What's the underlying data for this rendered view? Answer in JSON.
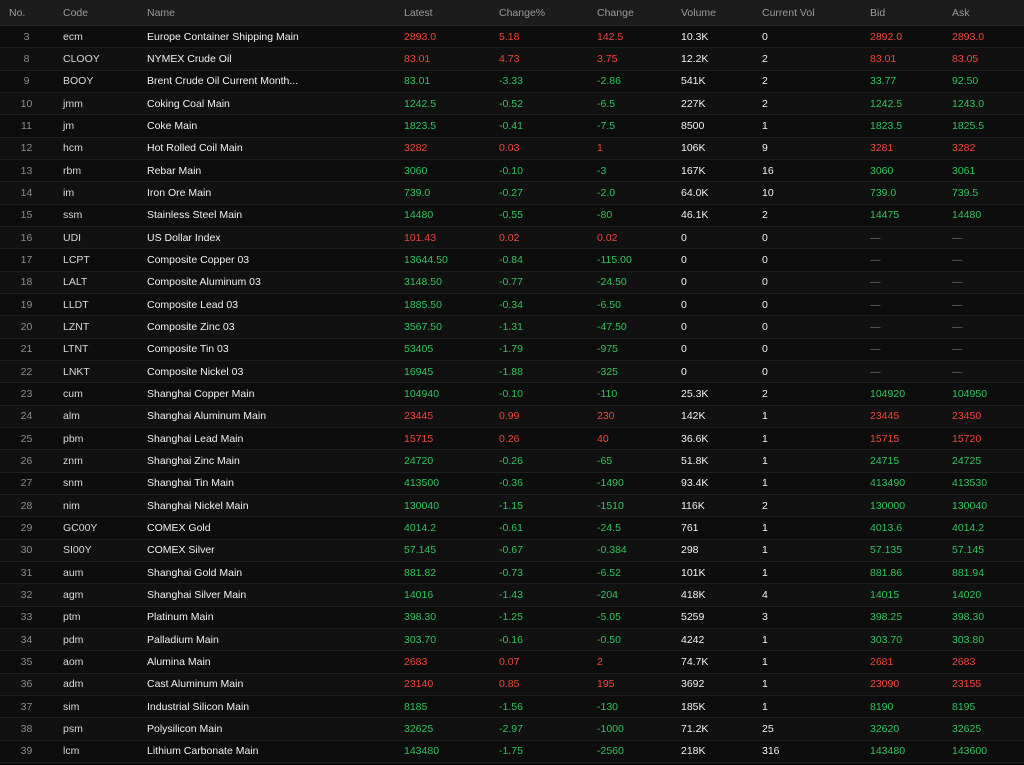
{
  "colors": {
    "up": "#f0443a",
    "down": "#2fc35a",
    "neutral": "#6e6e6e",
    "background": "#0d0d0d",
    "header": "#1c1c1c"
  },
  "headers": {
    "no": "No.",
    "code": "Code",
    "name": "Name",
    "latest": "Latest",
    "change_pct": "Change%",
    "change": "Change",
    "volume": "Volume",
    "current_vol": "Current Vol",
    "bid": "Bid",
    "ask": "Ask"
  },
  "rows": [
    {
      "no": "3",
      "code": "ecm",
      "name": "Europe Container Shipping Main",
      "latest": "2893.0",
      "pct": "5.18",
      "chg": "142.5",
      "vol": "10.3K",
      "cvol": "0",
      "bid": "2892.0",
      "ask": "2893.0",
      "dir": "up",
      "bid_dir": "up",
      "ask_dir": "up"
    },
    {
      "no": "8",
      "code": "CLOOY",
      "name": "NYMEX Crude Oil",
      "latest": "83.01",
      "pct": "4.73",
      "chg": "3.75",
      "vol": "12.2K",
      "cvol": "2",
      "bid": "83.01",
      "ask": "83.05",
      "dir": "up",
      "bid_dir": "up",
      "ask_dir": "up"
    },
    {
      "no": "9",
      "code": "BOOY",
      "name": "Brent Crude Oil Current Month...",
      "latest": "83.01",
      "pct": "-3.33",
      "chg": "-2.86",
      "vol": "541K",
      "cvol": "2",
      "bid": "33.77",
      "ask": "92.50",
      "dir": "down",
      "bid_dir": "down",
      "ask_dir": "down"
    },
    {
      "no": "10",
      "code": "jmm",
      "name": "Coking Coal Main",
      "latest": "1242.5",
      "pct": "-0.52",
      "chg": "-6.5",
      "vol": "227K",
      "cvol": "2",
      "bid": "1242.5",
      "ask": "1243.0",
      "dir": "down",
      "bid_dir": "down",
      "ask_dir": "down"
    },
    {
      "no": "11",
      "code": "jm",
      "name": "Coke Main",
      "latest": "1823.5",
      "pct": "-0.41",
      "chg": "-7.5",
      "vol": "8500",
      "cvol": "1",
      "bid": "1823.5",
      "ask": "1825.5",
      "dir": "down",
      "bid_dir": "down",
      "ask_dir": "down"
    },
    {
      "no": "12",
      "code": "hcm",
      "name": "Hot Rolled Coil Main",
      "latest": "3282",
      "pct": "0.03",
      "chg": "1",
      "vol": "106K",
      "cvol": "9",
      "bid": "3281",
      "ask": "3282",
      "dir": "up",
      "bid_dir": "up",
      "ask_dir": "up"
    },
    {
      "no": "13",
      "code": "rbm",
      "name": "Rebar Main",
      "latest": "3060",
      "pct": "-0.10",
      "chg": "-3",
      "vol": "167K",
      "cvol": "16",
      "bid": "3060",
      "ask": "3061",
      "dir": "down",
      "bid_dir": "down",
      "ask_dir": "down"
    },
    {
      "no": "14",
      "code": "im",
      "name": "Iron Ore Main",
      "latest": "739.0",
      "pct": "-0.27",
      "chg": "-2.0",
      "vol": "64.0K",
      "cvol": "10",
      "bid": "739.0",
      "ask": "739.5",
      "dir": "down",
      "bid_dir": "down",
      "ask_dir": "down"
    },
    {
      "no": "15",
      "code": "ssm",
      "name": "Stainless Steel Main",
      "latest": "14480",
      "pct": "-0.55",
      "chg": "-80",
      "vol": "46.1K",
      "cvol": "2",
      "bid": "14475",
      "ask": "14480",
      "dir": "down",
      "bid_dir": "down",
      "ask_dir": "down"
    },
    {
      "no": "16",
      "code": "UDI",
      "name": "US Dollar Index",
      "latest": "101.43",
      "pct": "0.02",
      "chg": "0.02",
      "vol": "0",
      "cvol": "0",
      "bid": "—",
      "ask": "—",
      "dir": "up",
      "bid_dir": "flat",
      "ask_dir": "flat"
    },
    {
      "no": "17",
      "code": "LCPT",
      "name": "Composite Copper 03",
      "latest": "13644.50",
      "pct": "-0.84",
      "chg": "-115.00",
      "vol": "0",
      "cvol": "0",
      "bid": "—",
      "ask": "—",
      "dir": "down",
      "bid_dir": "flat",
      "ask_dir": "flat"
    },
    {
      "no": "18",
      "code": "LALT",
      "name": "Composite Aluminum 03",
      "latest": "3148.50",
      "pct": "-0.77",
      "chg": "-24.50",
      "vol": "0",
      "cvol": "0",
      "bid": "—",
      "ask": "—",
      "dir": "down",
      "bid_dir": "flat",
      "ask_dir": "flat"
    },
    {
      "no": "19",
      "code": "LLDT",
      "name": "Composite Lead 03",
      "latest": "1885.50",
      "pct": "-0.34",
      "chg": "-6.50",
      "vol": "0",
      "cvol": "0",
      "bid": "—",
      "ask": "—",
      "dir": "down",
      "bid_dir": "flat",
      "ask_dir": "flat"
    },
    {
      "no": "20",
      "code": "LZNT",
      "name": "Composite Zinc 03",
      "latest": "3567.50",
      "pct": "-1.31",
      "chg": "-47.50",
      "vol": "0",
      "cvol": "0",
      "bid": "—",
      "ask": "—",
      "dir": "down",
      "bid_dir": "flat",
      "ask_dir": "flat"
    },
    {
      "no": "21",
      "code": "LTNT",
      "name": "Composite Tin 03",
      "latest": "53405",
      "pct": "-1.79",
      "chg": "-975",
      "vol": "0",
      "cvol": "0",
      "bid": "—",
      "ask": "—",
      "dir": "down",
      "bid_dir": "flat",
      "ask_dir": "flat"
    },
    {
      "no": "22",
      "code": "LNKT",
      "name": "Composite Nickel 03",
      "latest": "16945",
      "pct": "-1.88",
      "chg": "-325",
      "vol": "0",
      "cvol": "0",
      "bid": "—",
      "ask": "—",
      "dir": "down",
      "bid_dir": "flat",
      "ask_dir": "flat"
    },
    {
      "no": "23",
      "code": "cum",
      "name": "Shanghai Copper Main",
      "latest": "104940",
      "pct": "-0.10",
      "chg": "-110",
      "vol": "25.3K",
      "cvol": "2",
      "bid": "104920",
      "ask": "104950",
      "dir": "down",
      "bid_dir": "down",
      "ask_dir": "down"
    },
    {
      "no": "24",
      "code": "alm",
      "name": "Shanghai Aluminum Main",
      "latest": "23445",
      "pct": "0.99",
      "chg": "230",
      "vol": "142K",
      "cvol": "1",
      "bid": "23445",
      "ask": "23450",
      "dir": "up",
      "bid_dir": "up",
      "ask_dir": "up"
    },
    {
      "no": "25",
      "code": "pbm",
      "name": "Shanghai Lead Main",
      "latest": "15715",
      "pct": "0.26",
      "chg": "40",
      "vol": "36.6K",
      "cvol": "1",
      "bid": "15715",
      "ask": "15720",
      "dir": "up",
      "bid_dir": "up",
      "ask_dir": "up"
    },
    {
      "no": "26",
      "code": "znm",
      "name": "Shanghai Zinc Main",
      "latest": "24720",
      "pct": "-0.26",
      "chg": "-65",
      "vol": "51.8K",
      "cvol": "1",
      "bid": "24715",
      "ask": "24725",
      "dir": "down",
      "bid_dir": "down",
      "ask_dir": "down"
    },
    {
      "no": "27",
      "code": "snm",
      "name": "Shanghai Tin Main",
      "latest": "413500",
      "pct": "-0.36",
      "chg": "-1490",
      "vol": "93.4K",
      "cvol": "1",
      "bid": "413490",
      "ask": "413530",
      "dir": "down",
      "bid_dir": "down",
      "ask_dir": "down"
    },
    {
      "no": "28",
      "code": "nim",
      "name": "Shanghai Nickel Main",
      "latest": "130040",
      "pct": "-1.15",
      "chg": "-1510",
      "vol": "116K",
      "cvol": "2",
      "bid": "130000",
      "ask": "130040",
      "dir": "down",
      "bid_dir": "down",
      "ask_dir": "down"
    },
    {
      "no": "29",
      "code": "GC00Y",
      "name": "COMEX Gold",
      "latest": "4014.2",
      "pct": "-0.61",
      "chg": "-24.5",
      "vol": "761",
      "cvol": "1",
      "bid": "4013.6",
      "ask": "4014.2",
      "dir": "down",
      "bid_dir": "down",
      "ask_dir": "down"
    },
    {
      "no": "30",
      "code": "SI00Y",
      "name": "COMEX Silver",
      "latest": "57.145",
      "pct": "-0.67",
      "chg": "-0.384",
      "vol": "298",
      "cvol": "1",
      "bid": "57.135",
      "ask": "57.145",
      "dir": "down",
      "bid_dir": "down",
      "ask_dir": "down"
    },
    {
      "no": "31",
      "code": "aum",
      "name": "Shanghai Gold Main",
      "latest": "881.82",
      "pct": "-0.73",
      "chg": "-6.52",
      "vol": "101K",
      "cvol": "1",
      "bid": "881.86",
      "ask": "881.94",
      "dir": "down",
      "bid_dir": "down",
      "ask_dir": "down"
    },
    {
      "no": "32",
      "code": "agm",
      "name": "Shanghai Silver Main",
      "latest": "14016",
      "pct": "-1.43",
      "chg": "-204",
      "vol": "418K",
      "cvol": "4",
      "bid": "14015",
      "ask": "14020",
      "dir": "down",
      "bid_dir": "down",
      "ask_dir": "down"
    },
    {
      "no": "33",
      "code": "ptm",
      "name": "Platinum Main",
      "latest": "398.30",
      "pct": "-1.25",
      "chg": "-5.05",
      "vol": "5259",
      "cvol": "3",
      "bid": "398.25",
      "ask": "398.30",
      "dir": "down",
      "bid_dir": "down",
      "ask_dir": "down"
    },
    {
      "no": "34",
      "code": "pdm",
      "name": "Palladium Main",
      "latest": "303.70",
      "pct": "-0.16",
      "chg": "-0.50",
      "vol": "4242",
      "cvol": "1",
      "bid": "303.70",
      "ask": "303.80",
      "dir": "down",
      "bid_dir": "down",
      "ask_dir": "down"
    },
    {
      "no": "35",
      "code": "aom",
      "name": "Alumina Main",
      "latest": "2683",
      "pct": "0.07",
      "chg": "2",
      "vol": "74.7K",
      "cvol": "1",
      "bid": "2681",
      "ask": "2683",
      "dir": "up",
      "bid_dir": "up",
      "ask_dir": "up"
    },
    {
      "no": "36",
      "code": "adm",
      "name": "Cast Aluminum Main",
      "latest": "23140",
      "pct": "0.85",
      "chg": "195",
      "vol": "3692",
      "cvol": "1",
      "bid": "23090",
      "ask": "23155",
      "dir": "up",
      "bid_dir": "up",
      "ask_dir": "up"
    },
    {
      "no": "37",
      "code": "sim",
      "name": "Industrial Silicon Main",
      "latest": "8185",
      "pct": "-1.56",
      "chg": "-130",
      "vol": "185K",
      "cvol": "1",
      "bid": "8190",
      "ask": "8195",
      "dir": "down",
      "bid_dir": "down",
      "ask_dir": "down"
    },
    {
      "no": "38",
      "code": "psm",
      "name": "Polysilicon Main",
      "latest": "32625",
      "pct": "-2.97",
      "chg": "-1000",
      "vol": "71.2K",
      "cvol": "25",
      "bid": "32620",
      "ask": "32625",
      "dir": "down",
      "bid_dir": "down",
      "ask_dir": "down"
    },
    {
      "no": "39",
      "code": "lcm",
      "name": "Lithium Carbonate Main",
      "latest": "143480",
      "pct": "-1.75",
      "chg": "-2560",
      "vol": "218K",
      "cvol": "316",
      "bid": "143480",
      "ask": "143600",
      "dir": "down",
      "bid_dir": "down",
      "ask_dir": "down"
    }
  ]
}
